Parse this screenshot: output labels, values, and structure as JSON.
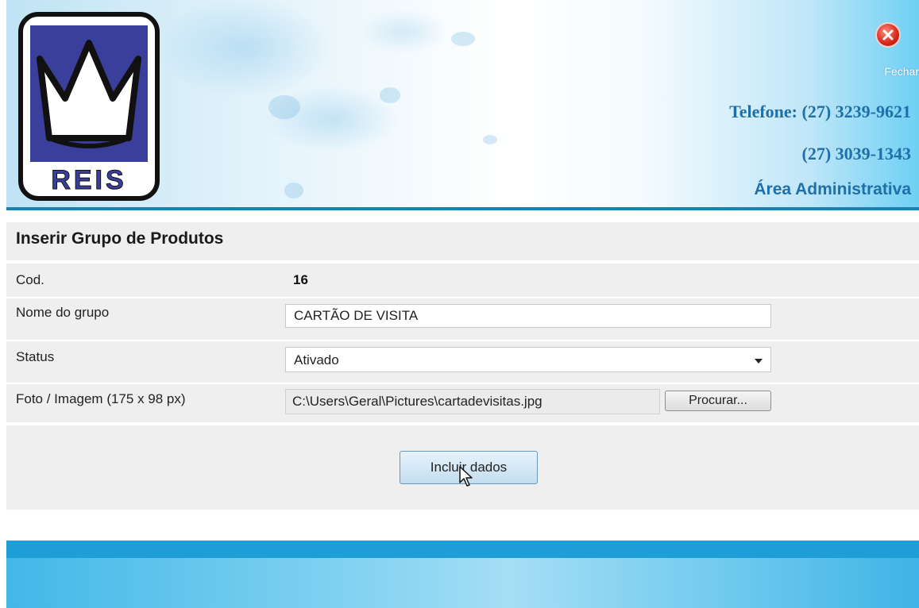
{
  "header": {
    "logo_text": "REIS",
    "close_label": "Fechar",
    "phone_line_1": "Telefone: (27) 3239-9621",
    "phone_line_2": "(27) 3039-1343",
    "area_label": "Área Administrativa",
    "accent_color": "#1f6fa8"
  },
  "form": {
    "title": "Inserir Grupo de Produtos",
    "fields": {
      "cod": {
        "label": "Cod.",
        "value": "16"
      },
      "group_name": {
        "label": "Nome do grupo",
        "value": "CARTÃO DE VISITA"
      },
      "status": {
        "label": "Status",
        "selected": "Ativado"
      },
      "image": {
        "label": "Foto / Imagem (175 x 98 px)",
        "path": "C:\\Users\\Geral\\Pictures\\cartadevisitas.jpg",
        "browse_label": "Procurar..."
      }
    },
    "submit_label": "Incluir dados"
  },
  "icons": [
    "close-icon",
    "logo-crown-icon",
    "mouse-cursor-icon",
    "dropdown-caret-icon"
  ],
  "colors": {
    "footer_bar": "#1e9ed6",
    "header_line": "#1f7fb0",
    "close_button": "#d8261a"
  }
}
